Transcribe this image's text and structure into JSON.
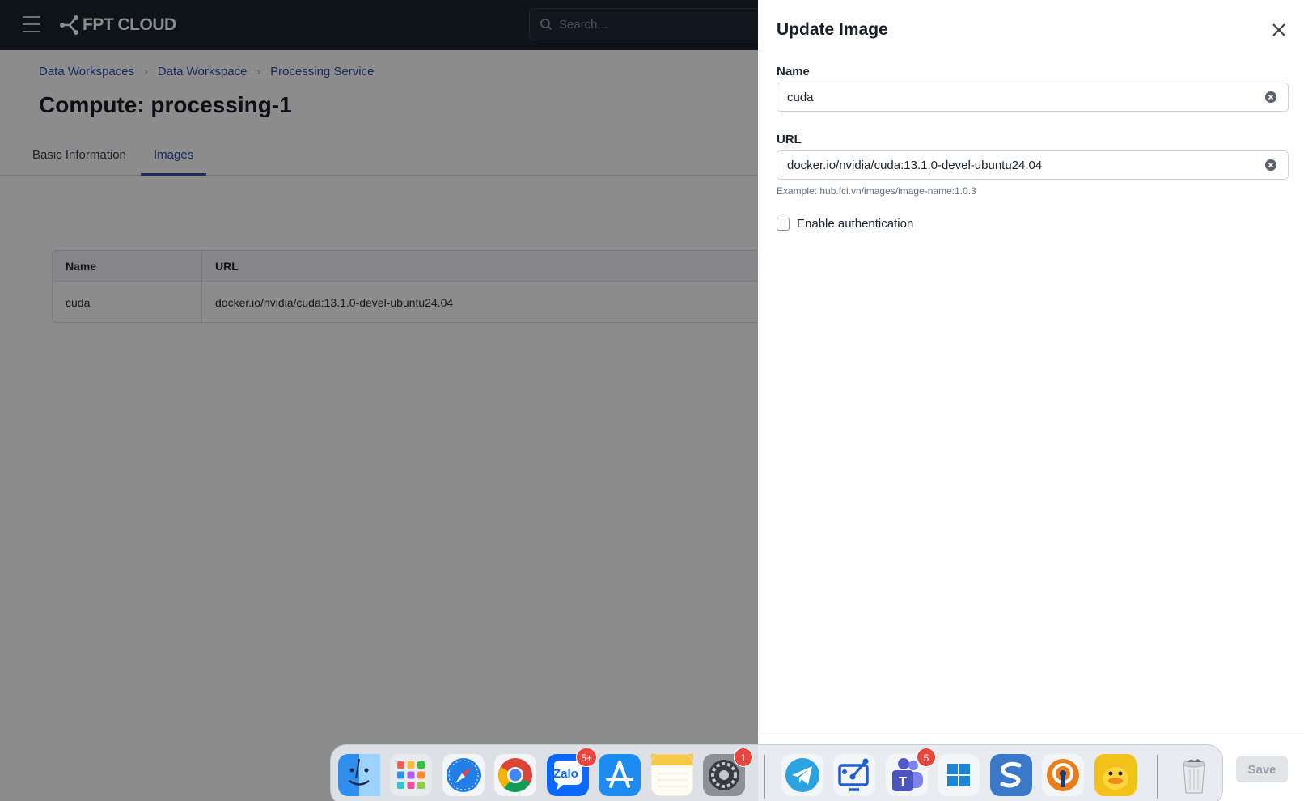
{
  "header": {
    "logo_text": "FPT CLOUD",
    "search_placeholder": "Search..."
  },
  "breadcrumb": [
    "Data Workspaces",
    "Data Workspace",
    "Processing Service"
  ],
  "page": {
    "title": "Compute: processing-1",
    "tabs": [
      {
        "label": "Basic Information",
        "active": false
      },
      {
        "label": "Images",
        "active": true
      }
    ]
  },
  "table": {
    "columns": [
      "Name",
      "URL"
    ],
    "rows": [
      {
        "name": "cuda",
        "url": "docker.io/nvidia/cuda:13.1.0-devel-ubuntu24.04"
      }
    ]
  },
  "panel": {
    "title": "Update Image",
    "name_label": "Name",
    "name_value": "cuda",
    "url_label": "URL",
    "url_value": "docker.io/nvidia/cuda:13.1.0-devel-ubuntu24.04",
    "url_hint": "Example: hub.fci.vn/images/image-name:1.0.3",
    "auth_label": "Enable authentication",
    "auth_checked": false,
    "save_label": "Save"
  },
  "dock": {
    "items": [
      {
        "name": "finder-icon",
        "badge": ""
      },
      {
        "name": "launchpad-icon",
        "badge": ""
      },
      {
        "name": "safari-icon",
        "badge": ""
      },
      {
        "name": "chrome-icon",
        "badge": ""
      },
      {
        "name": "zalo-icon",
        "badge": "5+",
        "text": "Zalo"
      },
      {
        "name": "app-store-icon",
        "badge": ""
      },
      {
        "name": "notes-icon",
        "badge": ""
      },
      {
        "name": "system-settings-icon",
        "badge": "1"
      },
      {
        "name": "telegram-icon",
        "badge": ""
      },
      {
        "name": "screen-share-icon",
        "badge": ""
      },
      {
        "name": "teams-icon",
        "badge": "5"
      },
      {
        "name": "windows-icon",
        "badge": ""
      },
      {
        "name": "sublime-icon",
        "badge": ""
      },
      {
        "name": "vpn-icon",
        "badge": ""
      },
      {
        "name": "duck-icon",
        "badge": ""
      },
      {
        "name": "trash-icon",
        "badge": ""
      }
    ]
  },
  "colors": {
    "header_bg": "#1b2331",
    "accent": "#2d4fa7",
    "badge": "#e8463e"
  }
}
